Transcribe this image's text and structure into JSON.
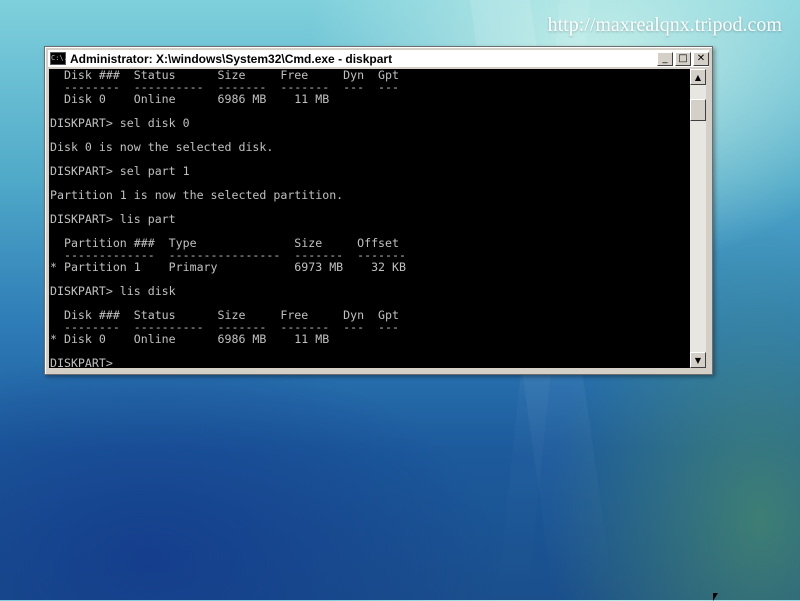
{
  "watermark": "http://maxrealqnx.tripod.com",
  "window": {
    "title": "Administrator: X:\\windows\\System32\\Cmd.exe - diskpart",
    "icon_text": "C:\\."
  },
  "controls": {
    "minimize": "_",
    "maximize": "□",
    "close": "✕"
  },
  "console": {
    "lines": [
      "  Disk ###  Status      Size     Free     Dyn  Gpt",
      "  --------  ----------  -------  -------  ---  ---",
      "  Disk 0    Online      6986 MB    11 MB",
      "",
      "DISKPART> sel disk 0",
      "",
      "Disk 0 is now the selected disk.",
      "",
      "DISKPART> sel part 1",
      "",
      "Partition 1 is now the selected partition.",
      "",
      "DISKPART> lis part",
      "",
      "  Partition ###  Type              Size     Offset",
      "  -------------  ----------------  -------  -------",
      "* Partition 1    Primary           6973 MB    32 KB",
      "",
      "DISKPART> lis disk",
      "",
      "  Disk ###  Status      Size     Free     Dyn  Gpt",
      "  --------  ----------  -------  -------  ---  ---",
      "* Disk 0    Online      6986 MB    11 MB",
      "",
      "DISKPART>"
    ]
  },
  "scrollbar": {
    "up_arrow": "▲",
    "down_arrow": "▼"
  },
  "icons": [
    "console-icon",
    "minimize-icon",
    "maximize-icon",
    "close-icon",
    "mouse-cursor-icon"
  ]
}
